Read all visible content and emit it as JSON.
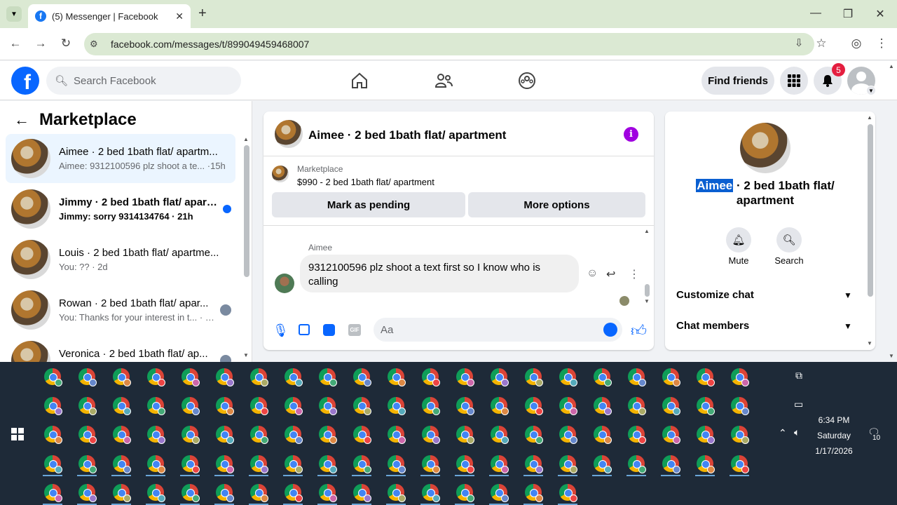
{
  "browser": {
    "tab_title": "(5) Messenger | Facebook",
    "url": "facebook.com/messages/t/899049459468007"
  },
  "header": {
    "search_placeholder": "Search Facebook",
    "find_friends": "Find friends",
    "notification_count": "5"
  },
  "left": {
    "title": "Marketplace",
    "conversations": [
      {
        "name": "Aimee · 2 bed 1bath flat/ apartm...",
        "preview": "Aimee: 9312100596 plz shoot a te... ·15h",
        "selected": true,
        "unread": false
      },
      {
        "name": "Jimmy · 2 bed 1bath flat/ apart...",
        "preview": "Jimmy: sorry 9314134764 · 21h",
        "selected": false,
        "unread": true
      },
      {
        "name": "Louis · 2 bed 1bath flat/ apartme...",
        "preview": "You: ?? · 2d",
        "selected": false,
        "unread": false
      },
      {
        "name": "Rowan · 2 bed 1bath flat/ apar...",
        "preview": "You: Thanks for your interest in t... · 2d",
        "selected": false,
        "unread": false
      },
      {
        "name": "Veronica · 2 bed 1bath flat/ ap...",
        "preview": "",
        "selected": false,
        "unread": false
      }
    ]
  },
  "chat": {
    "title": "Aimee · 2 bed 1bath flat/ apartment",
    "marketplace_label": "Marketplace",
    "listing": "$990 - 2 bed 1bath flat/ apartment",
    "mark_pending": "Mark as pending",
    "more_options": "More options",
    "sender": "Aimee",
    "message": "9312100596 plz shoot a text first so I know who is calling",
    "composer_placeholder": "Aa"
  },
  "details": {
    "name_highlight": "Aimee",
    "name_rest": " · 2 bed 1bath flat/ apartment",
    "mute": "Mute",
    "search": "Search",
    "customize": "Customize chat",
    "members": "Chat members"
  },
  "taskbar": {
    "time": "6:34 PM",
    "day": "Saturday",
    "date": "1/17/2026",
    "notif_count": "10"
  },
  "colors": {
    "fb_blue": "#0866ff",
    "tab_bg": "#dbe9d3",
    "taskbar": "#1e2a38"
  }
}
